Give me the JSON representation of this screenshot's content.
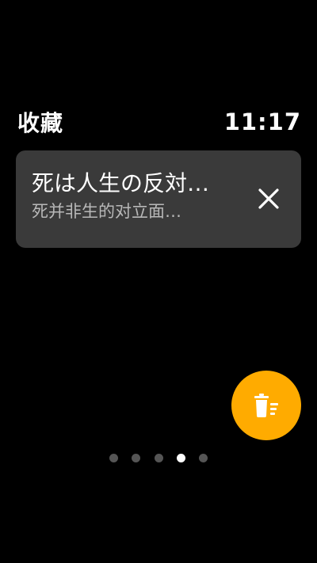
{
  "header": {
    "title": "收藏",
    "time": "11:17"
  },
  "favorites": [
    {
      "title": "死は人生の反対…",
      "subtitle": "死并非生的对立面…",
      "remove_icon": "close-icon"
    }
  ],
  "fab": {
    "icon": "clear-all-trash-icon",
    "color": "#ffab00"
  },
  "pager": {
    "count": 5,
    "active_index": 3
  },
  "colors": {
    "background": "#000000",
    "card": "#3a3a3a",
    "accent": "#ffab00",
    "dot_inactive": "#555555",
    "dot_active": "#ffffff"
  }
}
